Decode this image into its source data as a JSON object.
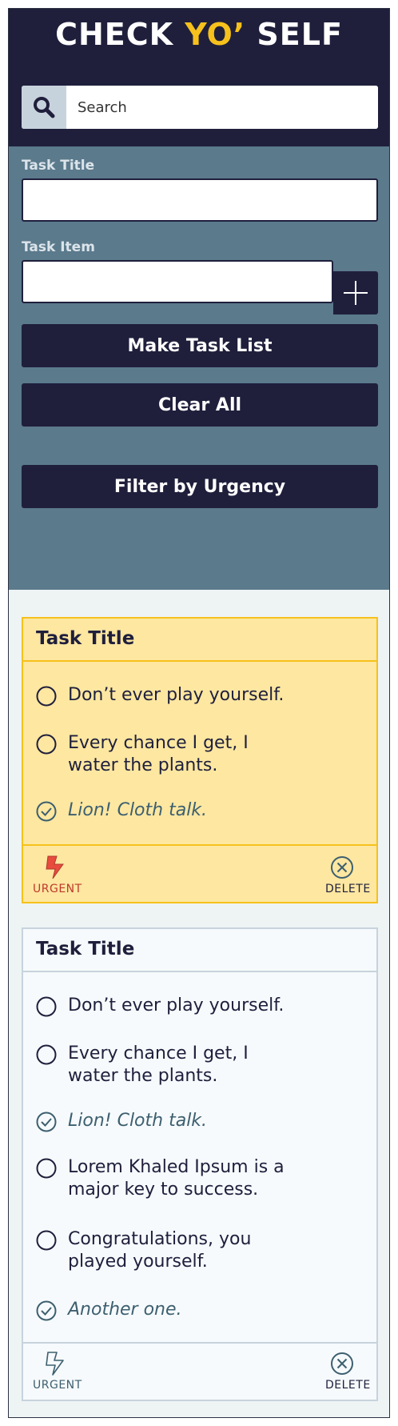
{
  "header": {
    "title_part1": "CHECK ",
    "title_accent": "YO’",
    "title_part2": " SELF",
    "search_placeholder": "Search"
  },
  "form": {
    "task_title_label": "Task Title",
    "task_item_label": "Task Item",
    "make_button": "Make Task List",
    "clear_button": "Clear All",
    "filter_button": "Filter by Urgency"
  },
  "cards": [
    {
      "title": "Task Title",
      "urgent": true,
      "items": [
        {
          "text": "Don’t ever play yourself.",
          "checked": false
        },
        {
          "text": "Every chance I get, I water the plants.",
          "checked": false
        },
        {
          "text": "Lion! Cloth talk.",
          "checked": true
        }
      ],
      "urgent_label": "URGENT",
      "delete_label": "DELETE"
    },
    {
      "title": "Task Title",
      "urgent": false,
      "items": [
        {
          "text": "Don’t ever play yourself.",
          "checked": false
        },
        {
          "text": "Every chance I get, I water the plants.",
          "checked": false
        },
        {
          "text": "Lion! Cloth talk.",
          "checked": true
        },
        {
          "text": "Lorem Khaled Ipsum is a major key to success.",
          "checked": false
        },
        {
          "text": "Congratulations, you played yourself.",
          "checked": false
        },
        {
          "text": "Another one.",
          "checked": true
        }
      ],
      "urgent_label": "URGENT",
      "delete_label": "DELETE"
    }
  ],
  "colors": {
    "navy": "#1f1f3c",
    "accent_yellow": "#f6c11c",
    "slate_panel": "#5b7a8c",
    "urgent_card_bg": "#fde7a1",
    "urgent_red": "#c0392b",
    "check_teal": "#3d5f6f"
  }
}
